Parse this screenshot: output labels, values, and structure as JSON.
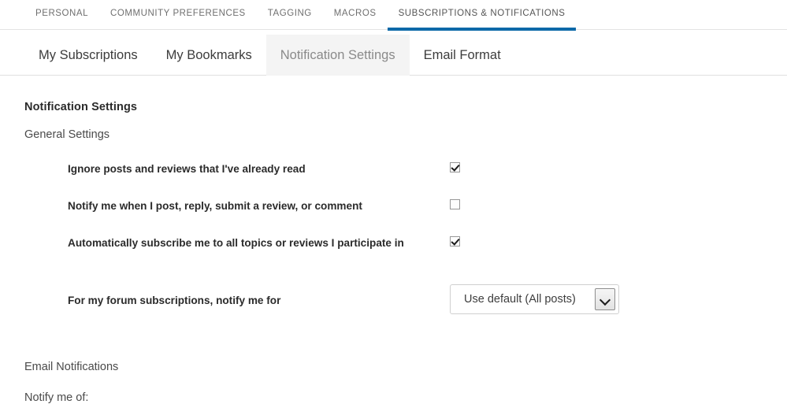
{
  "top_tabs": [
    {
      "label": "PERSONAL",
      "active": false
    },
    {
      "label": "COMMUNITY PREFERENCES",
      "active": false
    },
    {
      "label": "TAGGING",
      "active": false
    },
    {
      "label": "MACROS",
      "active": false
    },
    {
      "label": "SUBSCRIPTIONS & NOTIFICATIONS",
      "active": true
    }
  ],
  "sub_tabs": [
    {
      "label": "My Subscriptions",
      "active": false
    },
    {
      "label": "My Bookmarks",
      "active": false
    },
    {
      "label": "Notification Settings",
      "active": true
    },
    {
      "label": "Email Format",
      "active": false
    }
  ],
  "main": {
    "page_title": "Notification Settings",
    "general_section_title": "General Settings",
    "rows": [
      {
        "label": "Ignore posts and reviews that I've already read",
        "control": "checkbox",
        "checked": true
      },
      {
        "label": "Notify me when I post, reply, submit a review, or comment",
        "control": "checkbox",
        "checked": false
      },
      {
        "label": "Automatically subscribe me to all topics or reviews I participate in",
        "control": "checkbox",
        "checked": true
      },
      {
        "label": "For my forum subscriptions, notify me for",
        "control": "select",
        "value": "Use default (All posts)"
      }
    ],
    "email_section_title": "Email Notifications",
    "notify_me_of_label": "Notify me of:"
  },
  "colors": {
    "accent_blue": "#0c69a8",
    "active_tab_bg": "#f4f4f4",
    "border": "#e0e0e0",
    "text_primary": "#2b2b2b",
    "text_secondary": "#4a4a4a",
    "text_muted": "#8a8a8a"
  }
}
